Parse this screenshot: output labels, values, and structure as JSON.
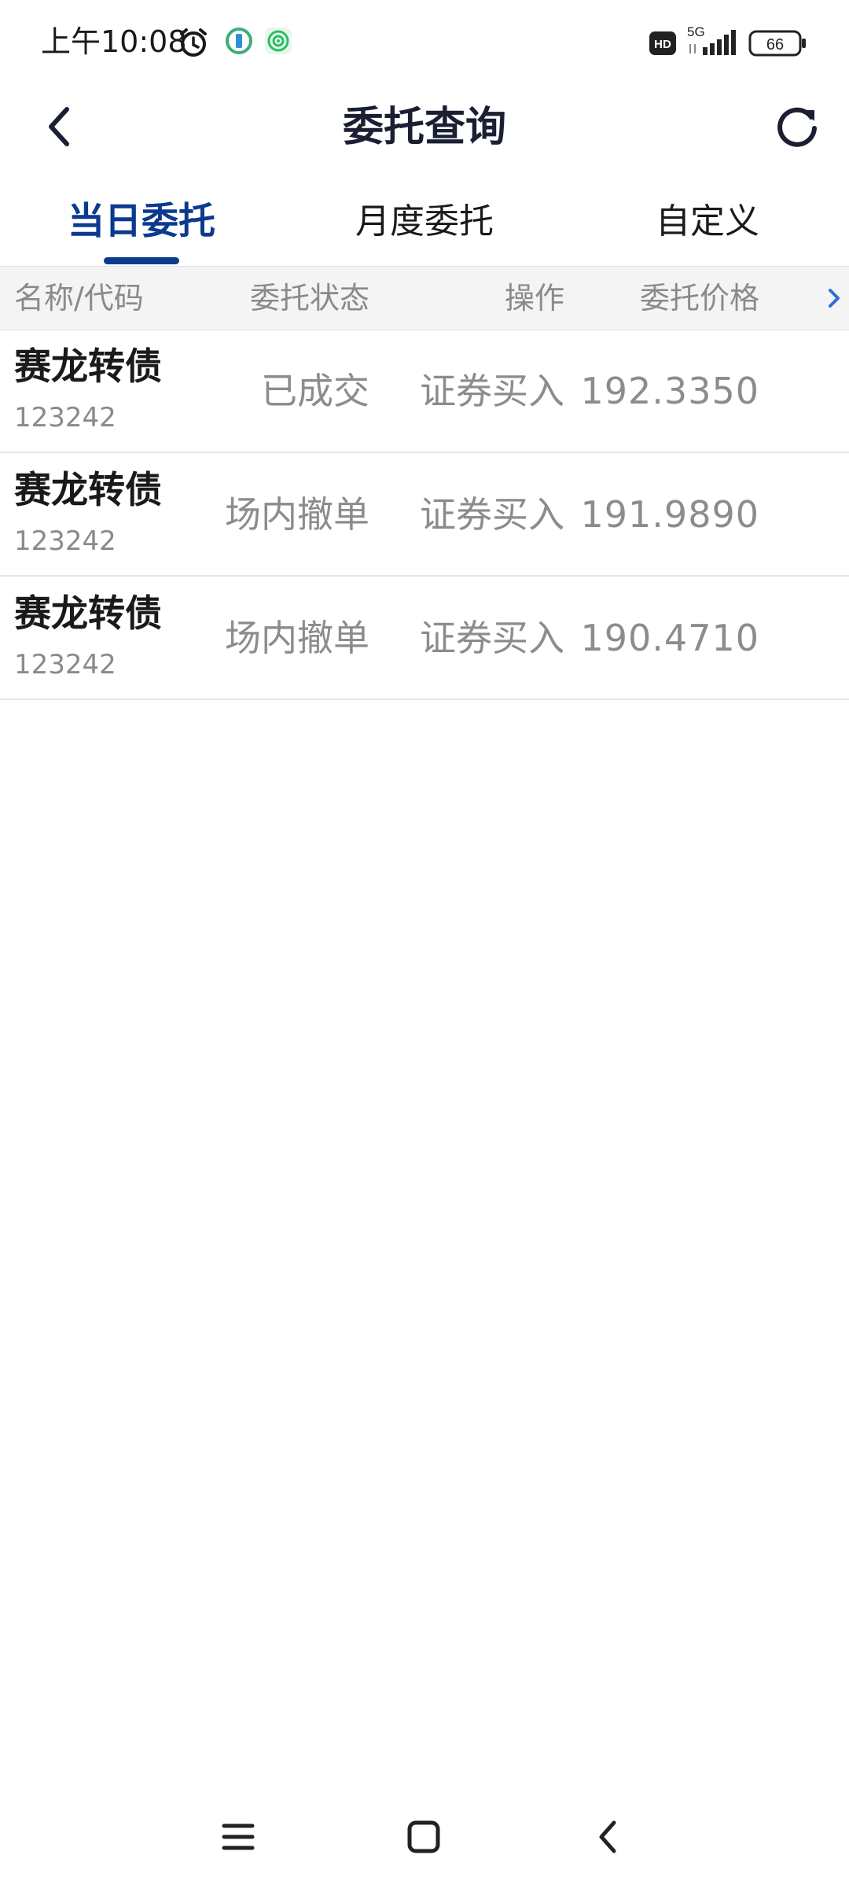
{
  "status_bar": {
    "time": "上午10:08",
    "network": "5G",
    "battery": "66",
    "hd": "HD"
  },
  "header": {
    "title": "委托查询"
  },
  "tabs": [
    {
      "label": "当日委托",
      "active": true
    },
    {
      "label": "月度委托",
      "active": false
    },
    {
      "label": "自定义",
      "active": false
    }
  ],
  "table": {
    "columns": [
      "名称/代码",
      "委托状态",
      "操作",
      "委托价格"
    ],
    "rows": [
      {
        "name": "赛龙转债",
        "code": "123242",
        "status": "已成交",
        "operation": "证券买入",
        "price": "192.3350"
      },
      {
        "name": "赛龙转债",
        "code": "123242",
        "status": "场内撤单",
        "operation": "证券买入",
        "price": "191.9890"
      },
      {
        "name": "赛龙转债",
        "code": "123242",
        "status": "场内撤单",
        "operation": "证券买入",
        "price": "190.4710"
      }
    ]
  },
  "colors": {
    "accent": "#0b3a8f",
    "title": "#1a1f33",
    "muted": "#8c8c8c",
    "header_bg": "#f4f4f4",
    "more_arrow": "#2f6fd6"
  },
  "icons": {
    "back": "chevron-left-icon",
    "refresh": "refresh-icon",
    "more_columns": "chevron-right-icon",
    "nav_menu": "menu-icon",
    "nav_home": "square-icon",
    "nav_back": "chevron-left-icon"
  }
}
